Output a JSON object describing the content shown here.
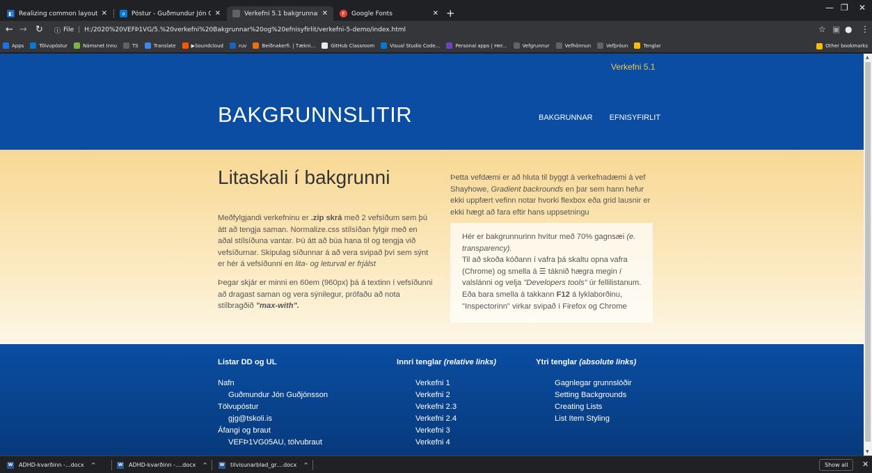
{
  "browser": {
    "tabs": [
      {
        "title": "Realizing common layouts using",
        "icon": "learn-icon",
        "color": "#1565c0"
      },
      {
        "title": "Póstur - Guðmundur Jón Guðjón",
        "icon": "outlook-icon",
        "color": "#0078d4"
      },
      {
        "title": "Verkefni 5.1 bakgrunnar",
        "icon": "page-icon",
        "color": "#5f6368"
      },
      {
        "title": "Google Fonts",
        "icon": "google-fonts-icon",
        "color": "#e94235"
      }
    ],
    "url_scheme": "File",
    "url": "H:/2020%20VEFÞ1VG/5.%20verkefni%20Bakgrunnar%20og%20efnisyfirlit/verkefni-5-demo/index.html",
    "bookmarks": [
      {
        "label": "Apps",
        "color": "#1a73e8"
      },
      {
        "label": "Tölvupóstur",
        "color": "#0078d4"
      },
      {
        "label": "Námsnet Innu",
        "color": "#7cb342"
      },
      {
        "label": "TS",
        "color": "#5f6368"
      },
      {
        "label": "Translate",
        "color": "#4285f4"
      },
      {
        "label": "▶Soundcloud",
        "color": "#ff5500"
      },
      {
        "label": "ruv",
        "color": "#1565c0"
      },
      {
        "label": "Beiðnakerfi. | Tækni...",
        "color": "#e8710a"
      },
      {
        "label": "GitHub Classroom",
        "color": "#e8eaed"
      },
      {
        "label": "Visual Studio Code...",
        "color": "#0078d4"
      },
      {
        "label": "Personal apps | Her...",
        "color": "#6f42c1"
      },
      {
        "label": "Vefgrunnur",
        "color": "#5f6368"
      },
      {
        "label": "Vefhönnun",
        "color": "#5f6368"
      },
      {
        "label": "Vefþróun",
        "color": "#5f6368"
      },
      {
        "label": "Tenglar",
        "color": "#fbbc04"
      }
    ],
    "other_bookmarks": "Other bookmarks"
  },
  "page": {
    "top_link": "Verkefni 5.1",
    "title": "BAKGRUNNSLITIR",
    "nav": [
      "BAKGRUNNAR",
      "EFNISYFIRLIT"
    ],
    "heading": "Litaskali í bakgrunni",
    "left": {
      "p1_a": "Meðfylgjandi verkefninu er ",
      "p1_b": ".zip skrá",
      "p1_c": " með 2 vefsíðum sem þú átt að tengja saman. Normalize.css stílsíðan fylgir með en aðal stílsíðuna vantar. Þú átt að búa hana til og tengja við vefsíðurnar. Skipulag síðunnar á að vera svipað því sem sýnt er hér á vefsíðunni en ",
      "p1_d": "lita- og leturval er frjálst",
      "p2_a": "Þegar skjár er minni en 60em (960px) þá á textinn í vefsíðunni að dragast saman og vera sýnilegur, prófaðu að nota stílbragðið ",
      "p2_b": "\"max-with\"."
    },
    "right": {
      "p_a": "Þetta vefdæmi er að hluta til byggt á verkefnadæmi á vef Shayhowe, ",
      "p_b": "Gradient backrounds",
      "p_c": " en þar sem hann hefur ekki uppfært vefinn notar hvorki flexbox eða grid lausnir er ekki hægt að fara eftir hans uppsetningu"
    },
    "box": {
      "l1": "Hér er bakgrunnurinn hvítur með 70% gagnsæi ",
      "l1_em": "(e. transparency).",
      "l2_a": "Til að skoða kóðann í vafra þá skaltu opna vafra (Chrome) og smella á ☰ táknið hægra megin ",
      "l2_b": "í",
      "l2_c": " valslánni og velja ",
      "l2_d": "\"Developers tools\"",
      "l2_e": " úr fellilistanum.",
      "l3_a": "Eða bara smella á takkann ",
      "l3_b": "F12",
      "l3_c": " á lyklaborðinu, \"Inspectorinn\" virkar svipað í Firefox og Chrome"
    },
    "footer": {
      "col1": {
        "title": "Listar DD og UL",
        "items": [
          {
            "text": "Nafn",
            "indent": false
          },
          {
            "text": "Guðmundur Jón Guðjónsson",
            "indent": true
          },
          {
            "text": "Tölvupóstur",
            "indent": false
          },
          {
            "text": "gjg@tskoli.is",
            "indent": true
          },
          {
            "text": "Áfangi og braut",
            "indent": false
          },
          {
            "text": "VEFÞ1VG05AU, tölvubraut",
            "indent": true
          }
        ]
      },
      "col2": {
        "title_a": "Innri tenglar ",
        "title_b": "(relative links)",
        "items": [
          "Verkefni 1",
          "Verkefni 2",
          "Verkefni 2.3",
          "Verkefni 2.4",
          "Verkefni 3",
          "Verkefni 4"
        ]
      },
      "col3": {
        "title_a": "Ytri tenglar ",
        "title_b": "(absolute links)",
        "items": [
          "Gagnlegar grunnslóðir",
          "Setting Backgrounds",
          "Creating Lists",
          "List Item Styling"
        ]
      }
    }
  },
  "downloads": [
    {
      "name": "ADHD-kvarðinn -...docx"
    },
    {
      "name": "ADHD-kvarðinn -....docx"
    },
    {
      "name": "tilvisunarblad_gr....docx"
    }
  ],
  "show_all": "Show all",
  "colors": {
    "header": "#0a4da2",
    "accent": "#f2c94c",
    "gradient_top": "#f8d894"
  }
}
